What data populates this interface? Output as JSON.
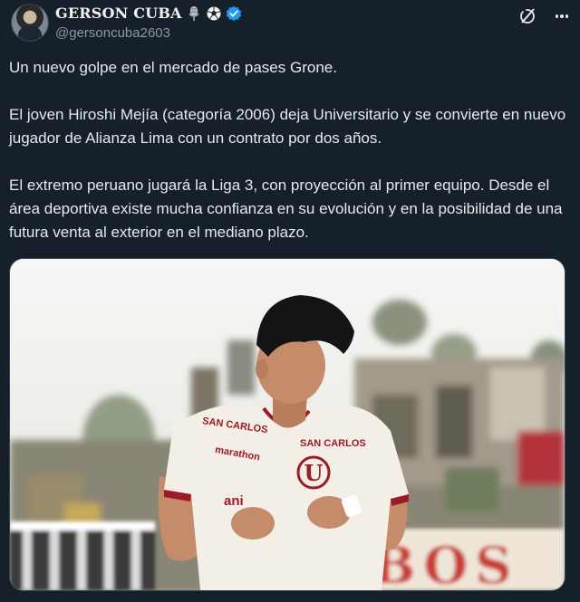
{
  "user": {
    "display_name": "GERSON CUBA",
    "handle": "@gersoncuba2603",
    "badges": [
      "microphone-icon",
      "soccer-ball-icon",
      "verified-badge-icon"
    ]
  },
  "header_icons": [
    "x-logo-icon",
    "more-options-icon"
  ],
  "tweet": {
    "paragraphs": [
      "Un nuevo golpe en el mercado de pases Grone.",
      "El joven Hiroshi Mejía (categoría 2006) deja Universitario y se convierte en nuevo jugador de Alianza Lima con un contrato por dos años.",
      "El extremo peruano jugará la Liga 3, con proyección al primer equipo. Desde el área deportiva existe mucha confianza en su evolución y en la posibilidad de una futura venta al exterior en el mediano plazo."
    ]
  },
  "media": {
    "jersey": {
      "sponsor_chest_right": "SAN CARLOS",
      "sponsor_chest_left": "SAN CARLOS",
      "sponsor_mid": "marathon",
      "crest": "U",
      "sponsor_lower": "ani"
    },
    "banner_text": "BOS"
  },
  "colors": {
    "background": "#15202b",
    "text": "#e7e9ea",
    "secondary_text": "#8b98a5",
    "verified": "#1d9bf0",
    "jersey_trim": "#9b1c24"
  }
}
